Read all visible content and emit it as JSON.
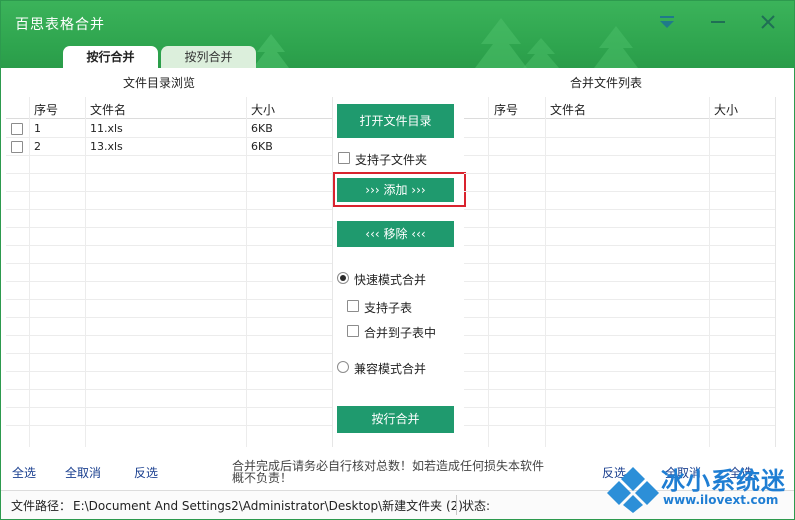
{
  "app": {
    "title": "百思表格合并"
  },
  "tabs": [
    {
      "label": "按行合并",
      "active": true
    },
    {
      "label": "按列合并",
      "active": false
    }
  ],
  "left_pane": {
    "title": "文件目录浏览",
    "columns": [
      "序号",
      "文件名",
      "大小"
    ],
    "rows": [
      {
        "index": "1",
        "name": "11.xls",
        "size": "6KB"
      },
      {
        "index": "2",
        "name": "13.xls",
        "size": "6KB"
      }
    ]
  },
  "right_pane": {
    "title": "合并文件列表",
    "columns": [
      "序号",
      "文件名",
      "大小"
    ]
  },
  "controls": {
    "open_dir": "打开文件目录",
    "include_subfolders": "支持子文件夹",
    "add": "››› 添加 ›››",
    "remove": "‹‹‹ 移除 ‹‹‹",
    "fast_mode": "快速模式合并",
    "support_subsheet": "支持子表",
    "merge_to_subsheet": "合并到子表中",
    "compat_mode": "兼容模式合并",
    "merge_button": "按行合并"
  },
  "bottom": {
    "select_all_left": "全选",
    "deselect_all_left": "全取消",
    "invert_left": "反选",
    "notice_line1": "合并完成后请务必自行核对总数！如若造成任何损失本软件",
    "notice_line2": "概不负责！",
    "invert_right": "反选",
    "deselect_all_right": "全取消",
    "select_all_right": "全选"
  },
  "status": {
    "path_label": "文件路径：",
    "path_value": "E:\\Document And Settings2\\Administrator\\Desktop\\新建文件夹 (2)",
    "state_label": "状态:"
  },
  "watermark": {
    "name": "冰小系统迷",
    "url": "www.ilovext.com"
  },
  "colors": {
    "titlebar": "#2ea44e",
    "button": "#1f9a6e",
    "highlight": "#d9232e",
    "link": "#1a3f8f"
  },
  "icons": [
    "menu-icon",
    "minimize-icon",
    "close-icon",
    "tree-icon"
  ]
}
